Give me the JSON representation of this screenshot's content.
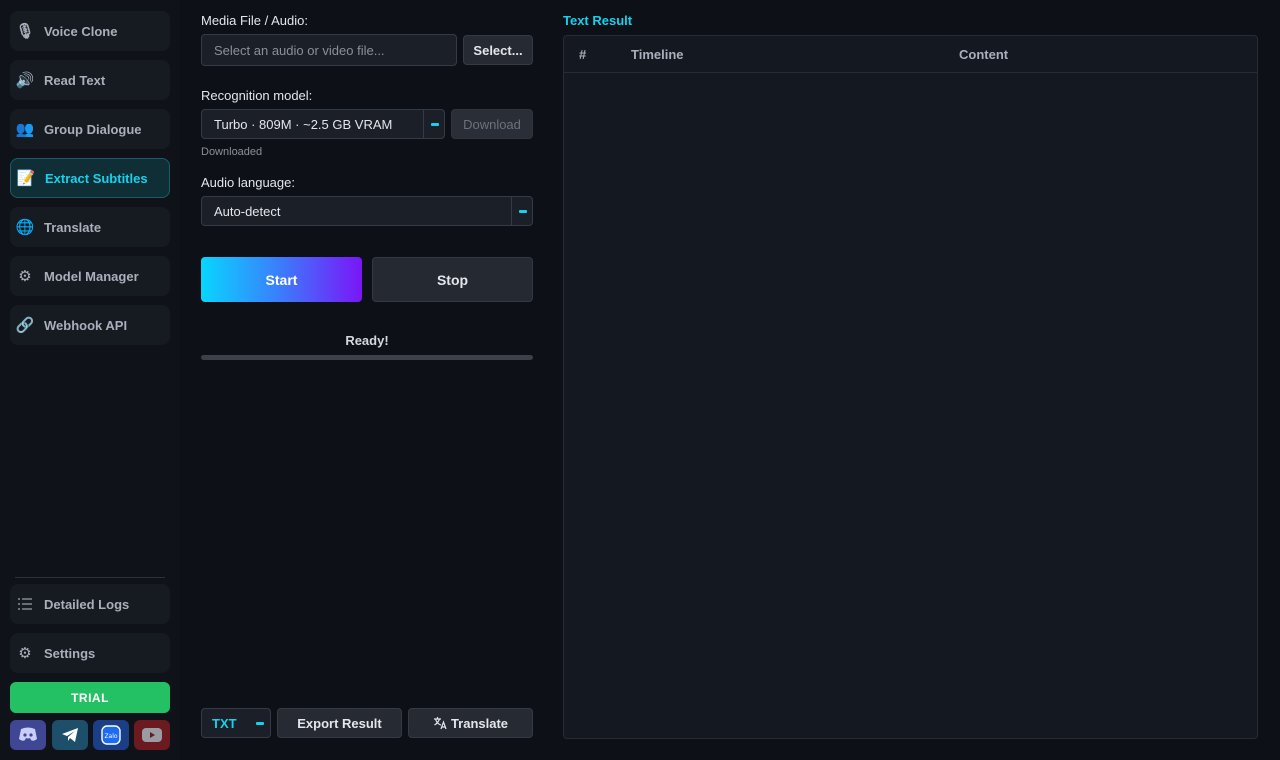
{
  "sidebar": {
    "items": [
      {
        "label": "Voice Clone",
        "icon": "microphone-icon",
        "glyph": "🎙"
      },
      {
        "label": "Read Text",
        "icon": "speaker-icon",
        "glyph": "🔊"
      },
      {
        "label": "Group Dialogue",
        "icon": "people-icon",
        "glyph": "👥"
      },
      {
        "label": "Extract Subtitles",
        "icon": "memo-icon",
        "glyph": "📝",
        "active": true
      },
      {
        "label": "Translate",
        "icon": "globe-icon",
        "glyph": "🌐"
      },
      {
        "label": "Model Manager",
        "icon": "gear-icon",
        "glyph": "⚙"
      },
      {
        "label": "Webhook API",
        "icon": "link-icon",
        "glyph": "🔗"
      }
    ],
    "bottom": [
      {
        "label": "Detailed Logs",
        "icon": "list-icon",
        "glyph": "☰"
      },
      {
        "label": "Settings",
        "icon": "gear-icon",
        "glyph": "⚙"
      }
    ],
    "trial_label": "TRIAL",
    "social": [
      {
        "name": "discord-icon",
        "color": "#5865f2"
      },
      {
        "name": "telegram-icon",
        "color": "#2aa3dd"
      },
      {
        "name": "zalo-icon",
        "color": "#1b6cf2"
      },
      {
        "name": "youtube-icon",
        "color": "#e02b2b"
      }
    ]
  },
  "media": {
    "label": "Media File / Audio:",
    "placeholder": "Select an audio or video file...",
    "select_button": "Select..."
  },
  "model": {
    "label": "Recognition model:",
    "value": "Turbo · 809M · ~2.5 GB VRAM",
    "download_button": "Download",
    "status": "Downloaded"
  },
  "language": {
    "label": "Audio language:",
    "value": "Auto-detect"
  },
  "actions": {
    "start": "Start",
    "stop": "Stop"
  },
  "status": {
    "text": "Ready!",
    "progress": 0
  },
  "footer": {
    "format": "TXT",
    "export": "Export Result",
    "translate": "Translate"
  },
  "result": {
    "title": "Text Result",
    "columns": [
      "#",
      "Timeline",
      "Content"
    ]
  },
  "colors": {
    "accent": "#17d1ec",
    "trial": "#24c064",
    "start_gradient": [
      "#08d6ff",
      "#7a16f7"
    ]
  }
}
